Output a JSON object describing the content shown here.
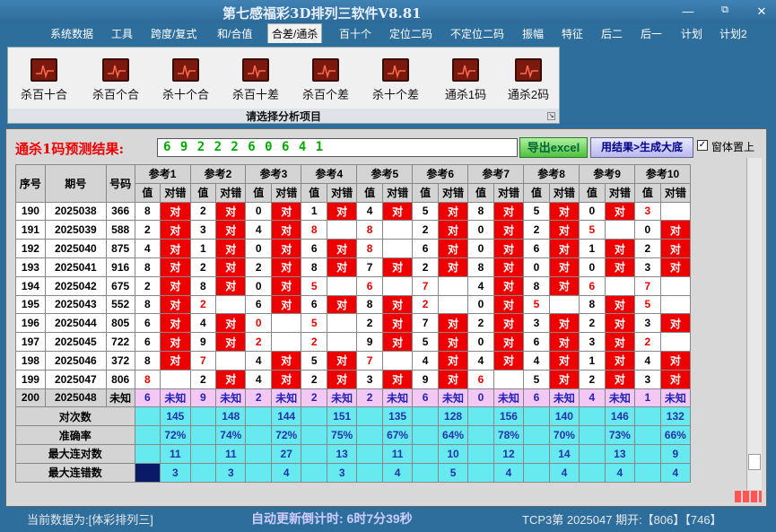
{
  "app": {
    "title": "第七感福彩3D排列三软件V8.81"
  },
  "menu": [
    "系统数据",
    "工具",
    "跨度/复式",
    "和/合值",
    "合差/通杀",
    "百十个",
    "定位二码",
    "不定位二码",
    "振幅",
    "特征",
    "后二",
    "后一",
    "计划",
    "计划2"
  ],
  "ribbon": {
    "buttons": [
      "杀百十合",
      "杀百个合",
      "杀十个合",
      "杀百十差",
      "杀百个差",
      "杀十个差",
      "通杀1码",
      "通杀2码"
    ],
    "group_label": "请选择分析项目"
  },
  "prediction": {
    "label": "通杀1码预测结果:",
    "digits": "6 9 2 2 2 6 0 6 4 1",
    "export_button": "导出excel",
    "generate_button": "用结果>生成大底",
    "ontop_label": "窗体置上"
  },
  "table": {
    "headers": {
      "seq": "序号",
      "period": "期号",
      "code": "号码",
      "refs": [
        "参考1",
        "参考2",
        "参考3",
        "参考4",
        "参考5",
        "参考6",
        "参考7",
        "参考8",
        "参考9",
        "参考10"
      ],
      "value": "值",
      "right_wrong": "对错",
      "right": "对"
    },
    "rows": [
      {
        "seq": "190",
        "period": "2025038",
        "code": "366",
        "vals": [
          "8",
          "2",
          "0",
          "1",
          "4",
          "5",
          "8",
          "5",
          "0",
          "3"
        ],
        "ok": [
          1,
          1,
          1,
          1,
          1,
          1,
          1,
          1,
          1,
          0
        ]
      },
      {
        "seq": "191",
        "period": "2025039",
        "code": "588",
        "vals": [
          "2",
          "3",
          "4",
          "8",
          "8",
          "2",
          "0",
          "2",
          "5",
          "0"
        ],
        "ok": [
          1,
          1,
          1,
          0,
          0,
          1,
          1,
          1,
          0,
          1
        ]
      },
      {
        "seq": "192",
        "period": "2025040",
        "code": "875",
        "vals": [
          "4",
          "1",
          "0",
          "6",
          "8",
          "6",
          "0",
          "6",
          "1",
          "2"
        ],
        "ok": [
          1,
          1,
          1,
          1,
          0,
          1,
          1,
          1,
          1,
          1
        ]
      },
      {
        "seq": "193",
        "period": "2025041",
        "code": "916",
        "vals": [
          "8",
          "2",
          "2",
          "8",
          "7",
          "2",
          "8",
          "0",
          "0",
          "3"
        ],
        "ok": [
          1,
          1,
          1,
          1,
          1,
          1,
          1,
          1,
          1,
          1
        ]
      },
      {
        "seq": "194",
        "period": "2025042",
        "code": "675",
        "vals": [
          "2",
          "8",
          "0",
          "5",
          "6",
          "7",
          "4",
          "8",
          "6",
          "7"
        ],
        "ok": [
          1,
          1,
          1,
          0,
          0,
          0,
          1,
          1,
          0,
          0
        ]
      },
      {
        "seq": "195",
        "period": "2025043",
        "code": "552",
        "vals": [
          "8",
          "2",
          "6",
          "6",
          "8",
          "2",
          "0",
          "5",
          "8",
          "5"
        ],
        "ok": [
          1,
          0,
          1,
          1,
          1,
          0,
          1,
          0,
          1,
          0
        ]
      },
      {
        "seq": "196",
        "period": "2025044",
        "code": "805",
        "vals": [
          "6",
          "4",
          "0",
          "5",
          "2",
          "7",
          "2",
          "3",
          "2",
          "3"
        ],
        "ok": [
          1,
          1,
          0,
          0,
          1,
          1,
          1,
          1,
          1,
          1
        ]
      },
      {
        "seq": "197",
        "period": "2025045",
        "code": "722",
        "vals": [
          "6",
          "9",
          "2",
          "2",
          "9",
          "5",
          "0",
          "6",
          "3",
          "2"
        ],
        "ok": [
          1,
          1,
          0,
          0,
          1,
          1,
          1,
          1,
          1,
          0
        ]
      },
      {
        "seq": "198",
        "period": "2025046",
        "code": "372",
        "vals": [
          "8",
          "7",
          "4",
          "5",
          "7",
          "4",
          "4",
          "4",
          "1",
          "4"
        ],
        "ok": [
          1,
          0,
          1,
          1,
          0,
          1,
          1,
          1,
          1,
          1
        ]
      },
      {
        "seq": "199",
        "period": "2025047",
        "code": "806",
        "vals": [
          "8",
          "2",
          "4",
          "2",
          "3",
          "9",
          "6",
          "5",
          "2",
          "3"
        ],
        "ok": [
          0,
          1,
          1,
          1,
          1,
          1,
          0,
          1,
          1,
          1
        ]
      }
    ],
    "prediction_row": {
      "seq": "200",
      "period": "2025048",
      "code": "未知",
      "vals": [
        "6",
        "9",
        "2",
        "2",
        "2",
        "6",
        "0",
        "6",
        "4",
        "1"
      ],
      "status": "未知"
    },
    "stats": [
      {
        "label": "对次数",
        "values": [
          "145",
          "148",
          "144",
          "151",
          "135",
          "128",
          "156",
          "140",
          "146",
          "132"
        ]
      },
      {
        "label": "准确率",
        "values": [
          "72%",
          "74%",
          "72%",
          "75%",
          "67%",
          "64%",
          "78%",
          "70%",
          "73%",
          "66%"
        ]
      },
      {
        "label": "最大连对数",
        "values": [
          "11",
          "11",
          "27",
          "13",
          "11",
          "10",
          "12",
          "14",
          "13",
          "9"
        ]
      },
      {
        "label": "最大连错数",
        "values": [
          "3",
          "3",
          "4",
          "3",
          "4",
          "5",
          "4",
          "4",
          "4",
          "4"
        ]
      }
    ]
  },
  "status": {
    "data_source": "当前数据为:[体彩排列三]",
    "timer": "自动更新倒计时: 6时7分39秒",
    "info": "TCP3第 2025047 期开:【806】【746】"
  }
}
